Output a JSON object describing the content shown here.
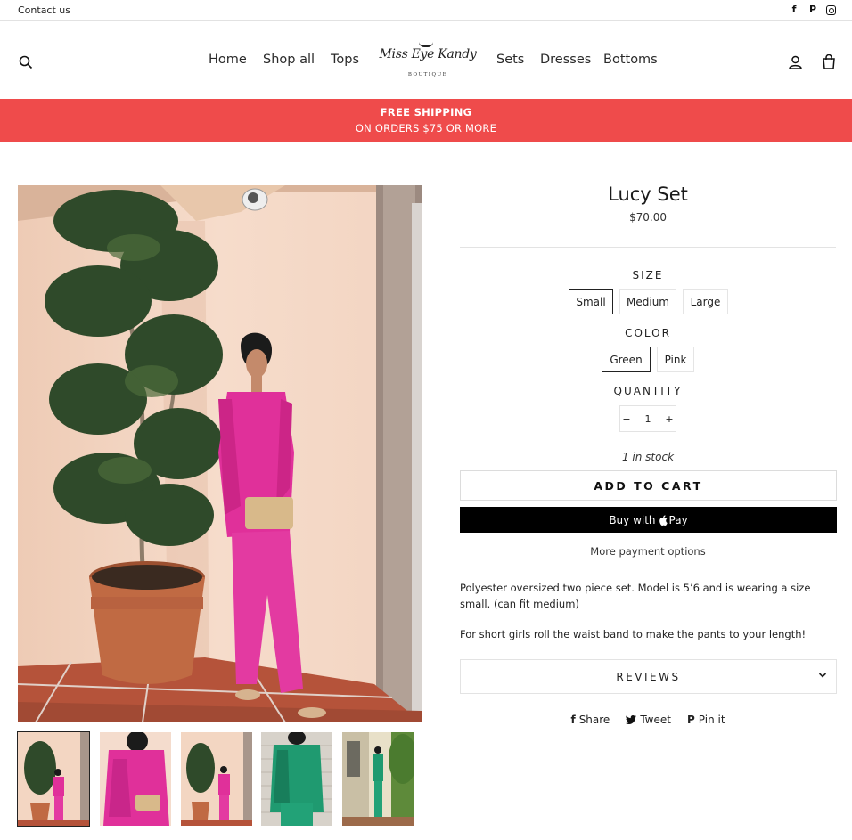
{
  "topbar": {
    "contact_label": "Contact us",
    "socials": [
      {
        "icon": "facebook-icon",
        "glyph": "f"
      },
      {
        "icon": "pinterest-icon",
        "glyph": "P"
      },
      {
        "icon": "instagram-icon",
        "glyph": ""
      }
    ]
  },
  "header": {
    "nav_left": [
      "Home",
      "Shop all",
      "Tops"
    ],
    "nav_right": [
      "Sets",
      "Dresses",
      "Bottoms"
    ],
    "logo_text": "Miss Eye Kandy",
    "logo_subtext": "BOUTIQUE"
  },
  "promo": {
    "line1": "FREE SHIPPING",
    "line2": "ON ORDERS $75 OR MORE",
    "color": "#ef4b4b"
  },
  "product": {
    "title": "Lucy Set",
    "price": "$70.00",
    "size_label": "SIZE",
    "sizes": [
      "Small",
      "Medium",
      "Large"
    ],
    "selected_size": "Small",
    "color_label": "COLOR",
    "colors": [
      "Green",
      "Pink"
    ],
    "selected_color": "Green",
    "quantity_label": "QUANTITY",
    "quantity_minus": "−",
    "quantity_value": "1",
    "quantity_plus": "+",
    "stock": "1 in stock",
    "add_to_cart": "ADD TO CART",
    "buy_with_prefix": "Buy with",
    "buy_with_suffix": "Pay",
    "more_payment": "More payment options",
    "description_1": "Polyester oversized two piece set. Model is 5’6 and is wearing a size small. (can fit medium)",
    "description_2": "For short girls roll the waist band to make the pants to your length!",
    "reviews_label": "REVIEWS"
  },
  "share": [
    {
      "icon": "facebook-icon",
      "glyph": "f",
      "label": "Share"
    },
    {
      "icon": "twitter-icon",
      "glyph": "🐦",
      "label": "Tweet"
    },
    {
      "icon": "pinterest-icon",
      "glyph": "P",
      "label": "Pin it"
    }
  ]
}
